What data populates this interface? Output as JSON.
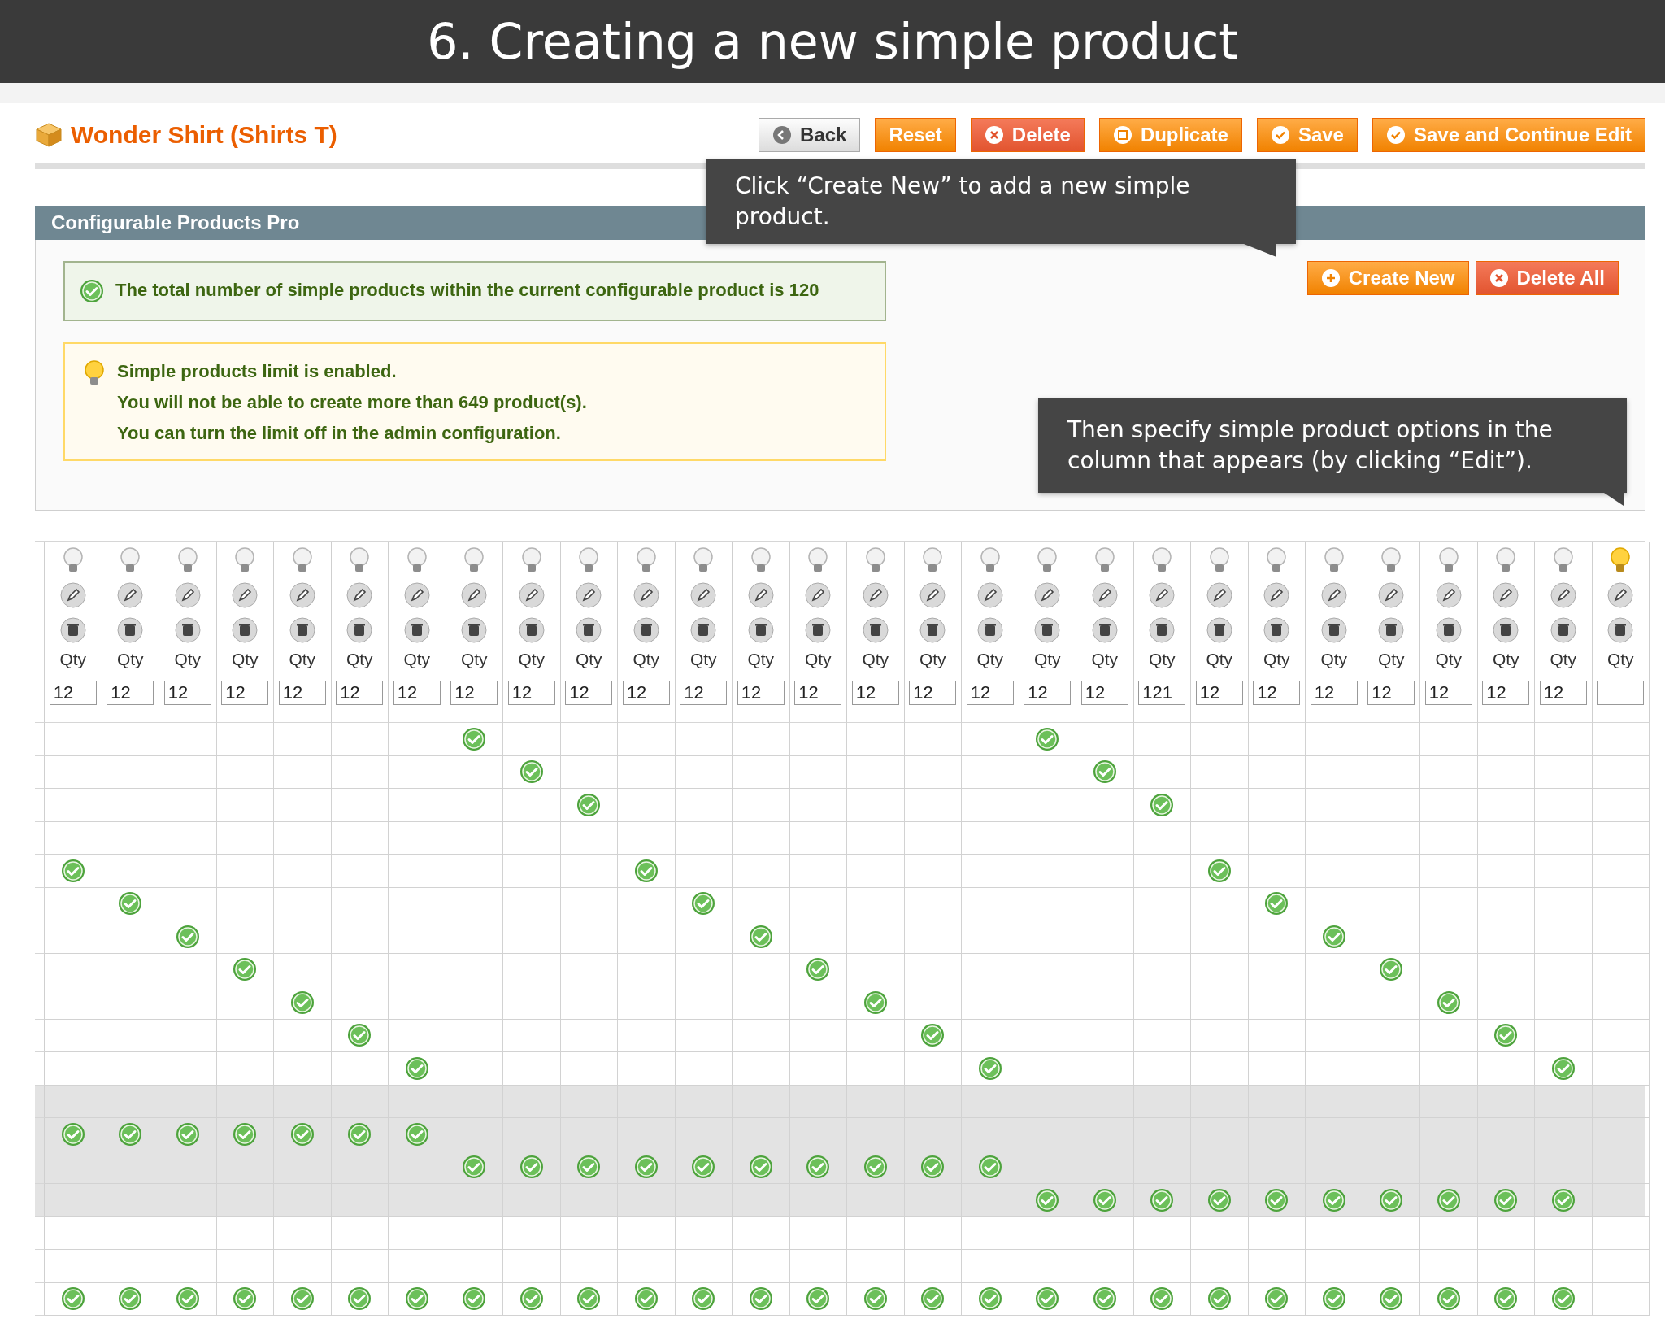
{
  "banner": {
    "title": "6. Creating a new simple product"
  },
  "product": {
    "title": "Wonder Shirt (Shirts T)"
  },
  "buttons": [
    {
      "label": "Back",
      "kind": "back"
    },
    {
      "label": "Reset",
      "kind": "plain"
    },
    {
      "label": "Delete",
      "kind": "delete"
    },
    {
      "label": "Duplicate",
      "kind": "duplicate"
    },
    {
      "label": "Save",
      "kind": "save"
    },
    {
      "label": "Save and Continue Edit",
      "kind": "save"
    }
  ],
  "section": {
    "title": "Configurable Products Pro",
    "actions": [
      {
        "label": "Create New",
        "kind": "add"
      },
      {
        "label": "Delete All",
        "kind": "delete"
      }
    ]
  },
  "notices": [
    {
      "kind": "success",
      "lines": [
        "The total number of simple products within the current configurable product is 120"
      ]
    },
    {
      "kind": "tip",
      "lines": [
        "Simple products limit is enabled.",
        "You will not be able to create more than 649 product(s).",
        "You can turn the limit off in the admin configuration."
      ]
    }
  ],
  "grid": {
    "columns": [
      {
        "label": "Qty",
        "qty": "12",
        "bulb_on": false
      },
      {
        "label": "Qty",
        "qty": "12",
        "bulb_on": false
      },
      {
        "label": "Qty",
        "qty": "12",
        "bulb_on": false
      },
      {
        "label": "Qty",
        "qty": "12",
        "bulb_on": false
      },
      {
        "label": "Qty",
        "qty": "12",
        "bulb_on": false
      },
      {
        "label": "Qty",
        "qty": "12",
        "bulb_on": false
      },
      {
        "label": "Qty",
        "qty": "12",
        "bulb_on": false
      },
      {
        "label": "Qty",
        "qty": "12",
        "bulb_on": false
      },
      {
        "label": "Qty",
        "qty": "12",
        "bulb_on": false
      },
      {
        "label": "Qty",
        "qty": "12",
        "bulb_on": false
      },
      {
        "label": "Qty",
        "qty": "12",
        "bulb_on": false
      },
      {
        "label": "Qty",
        "qty": "12",
        "bulb_on": false
      },
      {
        "label": "Qty",
        "qty": "12",
        "bulb_on": false
      },
      {
        "label": "Qty",
        "qty": "12",
        "bulb_on": false
      },
      {
        "label": "Qty",
        "qty": "12",
        "bulb_on": false
      },
      {
        "label": "Qty",
        "qty": "12",
        "bulb_on": false
      },
      {
        "label": "Qty",
        "qty": "12",
        "bulb_on": false
      },
      {
        "label": "Qty",
        "qty": "12",
        "bulb_on": false
      },
      {
        "label": "Qty",
        "qty": "12",
        "bulb_on": false
      },
      {
        "label": "Qty",
        "qty": "121",
        "bulb_on": false
      },
      {
        "label": "Qty",
        "qty": "12",
        "bulb_on": false
      },
      {
        "label": "Qty",
        "qty": "12",
        "bulb_on": false
      },
      {
        "label": "Qty",
        "qty": "12",
        "bulb_on": false
      },
      {
        "label": "Qty",
        "qty": "12",
        "bulb_on": false
      },
      {
        "label": "Qty",
        "qty": "12",
        "bulb_on": false
      },
      {
        "label": "Qty",
        "qty": "12",
        "bulb_on": false
      },
      {
        "label": "Qty",
        "qty": "12",
        "bulb_on": false
      },
      {
        "label": "Qty",
        "bulb_on": true
      }
    ],
    "rows": [
      {
        "shaded": false,
        "cells": [
          false,
          false,
          false,
          false,
          false,
          false,
          false,
          true,
          false,
          false,
          false,
          false,
          false,
          false,
          false,
          false,
          false,
          true,
          false,
          false,
          false,
          false,
          false,
          false,
          false,
          false,
          false,
          false
        ]
      },
      {
        "shaded": false,
        "cells": [
          false,
          false,
          false,
          false,
          false,
          false,
          false,
          false,
          true,
          false,
          false,
          false,
          false,
          false,
          false,
          false,
          false,
          false,
          true,
          false,
          false,
          false,
          false,
          false,
          false,
          false,
          false,
          false
        ]
      },
      {
        "shaded": false,
        "cells": [
          false,
          false,
          false,
          false,
          false,
          false,
          false,
          false,
          false,
          true,
          false,
          false,
          false,
          false,
          false,
          false,
          false,
          false,
          false,
          true,
          false,
          false,
          false,
          false,
          false,
          false,
          false,
          false
        ]
      },
      {
        "shaded": false,
        "cells": [
          false,
          false,
          false,
          false,
          false,
          false,
          false,
          false,
          false,
          false,
          false,
          false,
          false,
          false,
          false,
          false,
          false,
          false,
          false,
          false,
          false,
          false,
          false,
          false,
          false,
          false,
          false,
          false
        ]
      },
      {
        "shaded": false,
        "cells": [
          true,
          false,
          false,
          false,
          false,
          false,
          false,
          false,
          false,
          false,
          true,
          false,
          false,
          false,
          false,
          false,
          false,
          false,
          false,
          false,
          true,
          false,
          false,
          false,
          false,
          false,
          false,
          false
        ]
      },
      {
        "shaded": false,
        "cells": [
          false,
          true,
          false,
          false,
          false,
          false,
          false,
          false,
          false,
          false,
          false,
          true,
          false,
          false,
          false,
          false,
          false,
          false,
          false,
          false,
          false,
          true,
          false,
          false,
          false,
          false,
          false,
          false
        ]
      },
      {
        "shaded": false,
        "cells": [
          false,
          false,
          true,
          false,
          false,
          false,
          false,
          false,
          false,
          false,
          false,
          false,
          true,
          false,
          false,
          false,
          false,
          false,
          false,
          false,
          false,
          false,
          true,
          false,
          false,
          false,
          false,
          false
        ]
      },
      {
        "shaded": false,
        "cells": [
          false,
          false,
          false,
          true,
          false,
          false,
          false,
          false,
          false,
          false,
          false,
          false,
          false,
          true,
          false,
          false,
          false,
          false,
          false,
          false,
          false,
          false,
          false,
          true,
          false,
          false,
          false,
          false
        ]
      },
      {
        "shaded": false,
        "cells": [
          false,
          false,
          false,
          false,
          true,
          false,
          false,
          false,
          false,
          false,
          false,
          false,
          false,
          false,
          true,
          false,
          false,
          false,
          false,
          false,
          false,
          false,
          false,
          false,
          true,
          false,
          false,
          false
        ]
      },
      {
        "shaded": false,
        "cells": [
          false,
          false,
          false,
          false,
          false,
          true,
          false,
          false,
          false,
          false,
          false,
          false,
          false,
          false,
          false,
          true,
          false,
          false,
          false,
          false,
          false,
          false,
          false,
          false,
          false,
          true,
          false,
          false
        ]
      },
      {
        "shaded": false,
        "cells": [
          false,
          false,
          false,
          false,
          false,
          false,
          true,
          false,
          false,
          false,
          false,
          false,
          false,
          false,
          false,
          false,
          true,
          false,
          false,
          false,
          false,
          false,
          false,
          false,
          false,
          false,
          true,
          false
        ]
      },
      {
        "shaded": true,
        "cells": [
          false,
          false,
          false,
          false,
          false,
          false,
          false,
          false,
          false,
          false,
          false,
          false,
          false,
          false,
          false,
          false,
          false,
          false,
          false,
          false,
          false,
          false,
          false,
          false,
          false,
          false,
          false,
          false
        ]
      },
      {
        "shaded": true,
        "cells": [
          true,
          true,
          true,
          true,
          true,
          true,
          true,
          false,
          false,
          false,
          false,
          false,
          false,
          false,
          false,
          false,
          false,
          false,
          false,
          false,
          false,
          false,
          false,
          false,
          false,
          false,
          false,
          false
        ]
      },
      {
        "shaded": true,
        "cells": [
          false,
          false,
          false,
          false,
          false,
          false,
          false,
          true,
          true,
          true,
          true,
          true,
          true,
          true,
          true,
          true,
          true,
          false,
          false,
          false,
          false,
          false,
          false,
          false,
          false,
          false,
          false,
          false
        ]
      },
      {
        "shaded": true,
        "cells": [
          false,
          false,
          false,
          false,
          false,
          false,
          false,
          false,
          false,
          false,
          false,
          false,
          false,
          false,
          false,
          false,
          false,
          true,
          true,
          true,
          true,
          true,
          true,
          true,
          true,
          true,
          true,
          false
        ]
      },
      {
        "shaded": false,
        "cells": [
          false,
          false,
          false,
          false,
          false,
          false,
          false,
          false,
          false,
          false,
          false,
          false,
          false,
          false,
          false,
          false,
          false,
          false,
          false,
          false,
          false,
          false,
          false,
          false,
          false,
          false,
          false,
          false
        ]
      },
      {
        "shaded": false,
        "cells": [
          false,
          false,
          false,
          false,
          false,
          false,
          false,
          false,
          false,
          false,
          false,
          false,
          false,
          false,
          false,
          false,
          false,
          false,
          false,
          false,
          false,
          false,
          false,
          false,
          false,
          false,
          false,
          false
        ]
      },
      {
        "shaded": false,
        "cells": [
          true,
          true,
          true,
          true,
          true,
          true,
          true,
          true,
          true,
          true,
          true,
          true,
          true,
          true,
          true,
          true,
          true,
          true,
          true,
          true,
          true,
          true,
          true,
          true,
          true,
          true,
          true,
          false
        ]
      }
    ]
  },
  "tooltips": [
    {
      "text": "Click “Create New” to add a new simple product."
    },
    {
      "text": "Then specify simple product options in the column that appears (by clicking “Edit”)."
    }
  ]
}
